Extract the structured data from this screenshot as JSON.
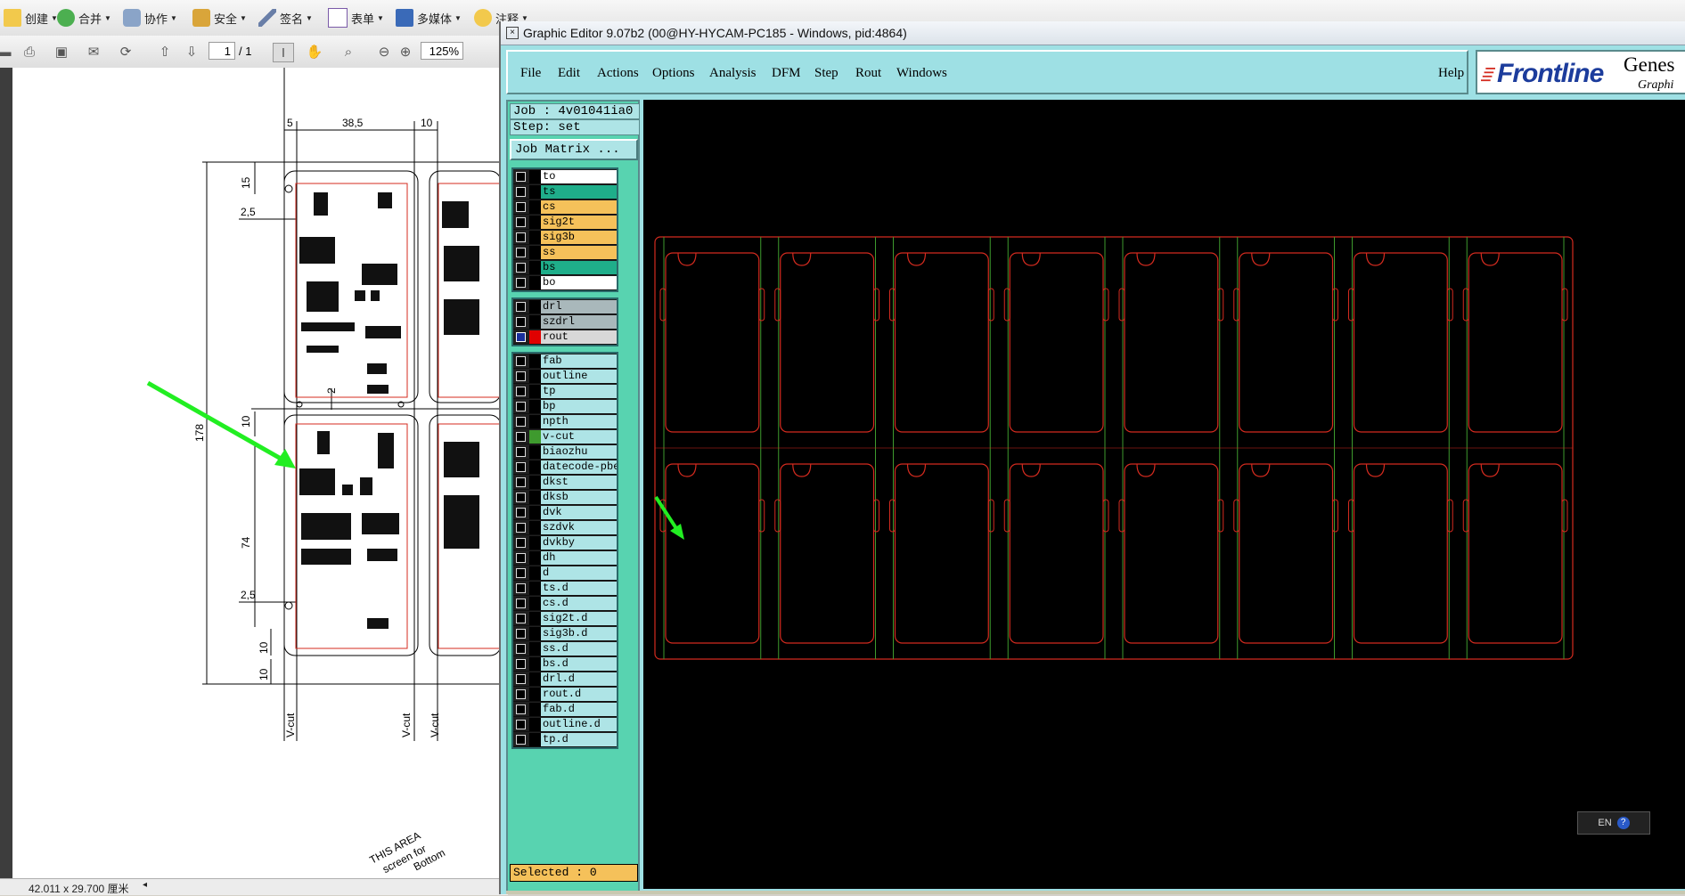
{
  "acrobat": {
    "toolbar1": [
      {
        "label": "创建",
        "icon": "create-icon"
      },
      {
        "label": "合并",
        "icon": "combine-icon"
      },
      {
        "label": "协作",
        "icon": "collaborate-icon"
      },
      {
        "label": "安全",
        "icon": "lock-icon"
      },
      {
        "label": "签名",
        "icon": "pen-icon"
      },
      {
        "label": "表单",
        "icon": "form-icon"
      },
      {
        "label": "多媒体",
        "icon": "multimedia-icon"
      },
      {
        "label": "注释",
        "icon": "comment-icon"
      }
    ],
    "page_current": "1",
    "page_total": "/ 1",
    "zoom": "125%",
    "status_size": "42.011 x 29.700 厘米",
    "drawing": {
      "dim_5": "5",
      "dim_38_5": "38,5",
      "dim_10_top": "10",
      "dim_15": "15",
      "dim_2_5_top": "2,5",
      "dim_178": "178",
      "dim_10_mid": "10",
      "dim_2": "2",
      "dim_74": "74",
      "dim_2_5_bot": "2,5",
      "dim_10_bot1": "10",
      "dim_10_bot2": "10",
      "vcut1": "V-cut",
      "vcut2": "V-cut",
      "vcut3": "V-cut",
      "note_line1": "THIS AREA",
      "note_line2": "screen for",
      "note_line3": "Bottom"
    }
  },
  "genesis": {
    "title": "Graphic Editor 9.07b2 (00@HY-HYCAM-PC185 - Windows, pid:4864)",
    "menu": [
      {
        "label": "File"
      },
      {
        "label": "Edit"
      },
      {
        "label": "Actions"
      },
      {
        "label": "Options"
      },
      {
        "label": "Analysis"
      },
      {
        "label": "DFM"
      },
      {
        "label": "Step"
      },
      {
        "label": "Rout"
      },
      {
        "label": "Windows"
      }
    ],
    "help": "Help",
    "logo_brand": "Frontline",
    "logo_product": "Genes",
    "logo_sub": "Graphi",
    "job": "Job : 4v01041ia0",
    "step": "Step: set",
    "job_matrix": "Job Matrix ...",
    "layer_groups": [
      {
        "layers": [
          {
            "name": "to",
            "color": "#ffffff",
            "swatch": "#000000"
          },
          {
            "name": "ts",
            "color": "#1fae8a",
            "swatch": "#000000"
          },
          {
            "name": "cs",
            "color": "#f5c15a",
            "swatch": "#000000"
          },
          {
            "name": "sig2t",
            "color": "#f5c15a",
            "swatch": "#000000"
          },
          {
            "name": "sig3b",
            "color": "#f5c15a",
            "swatch": "#000000"
          },
          {
            "name": "ss",
            "color": "#f5c15a",
            "swatch": "#000000"
          },
          {
            "name": "bs",
            "color": "#1fae8a",
            "swatch": "#000000"
          },
          {
            "name": "bo",
            "color": "#ffffff",
            "swatch": "#000000"
          }
        ]
      },
      {
        "layers": [
          {
            "name": "drl",
            "color": "#a9b8bb",
            "swatch": "#000000"
          },
          {
            "name": "szdrl",
            "color": "#a9b8bb",
            "swatch": "#000000"
          },
          {
            "name": "rout",
            "color": "#d8d8d8",
            "swatch": "#e00000",
            "checked": true
          }
        ]
      },
      {
        "layers": [
          {
            "name": "fab",
            "color": "#aee4e6",
            "swatch": "#000000"
          },
          {
            "name": "outline",
            "color": "#aee4e6",
            "swatch": "#000000"
          },
          {
            "name": "tp",
            "color": "#aee4e6",
            "swatch": "#000000"
          },
          {
            "name": "bp",
            "color": "#aee4e6",
            "swatch": "#000000"
          },
          {
            "name": "npth",
            "color": "#aee4e6",
            "swatch": "#000000"
          },
          {
            "name": "v-cut",
            "color": "#aee4e6",
            "swatch": "#3e9a2e"
          },
          {
            "name": "biaozhu",
            "color": "#aee4e6",
            "swatch": "#000000"
          },
          {
            "name": "datecode-pbe",
            "color": "#aee4e6",
            "swatch": "#000000"
          },
          {
            "name": "dkst",
            "color": "#aee4e6",
            "swatch": "#000000"
          },
          {
            "name": "dksb",
            "color": "#aee4e6",
            "swatch": "#000000"
          },
          {
            "name": "dvk",
            "color": "#aee4e6",
            "swatch": "#000000"
          },
          {
            "name": "szdvk",
            "color": "#aee4e6",
            "swatch": "#000000"
          },
          {
            "name": "dvkby",
            "color": "#aee4e6",
            "swatch": "#000000"
          },
          {
            "name": "dh",
            "color": "#aee4e6",
            "swatch": "#000000"
          },
          {
            "name": "d",
            "color": "#aee4e6",
            "swatch": "#000000"
          },
          {
            "name": "ts.d",
            "color": "#aee4e6",
            "swatch": "#000000"
          },
          {
            "name": "cs.d",
            "color": "#aee4e6",
            "swatch": "#000000"
          },
          {
            "name": "sig2t.d",
            "color": "#aee4e6",
            "swatch": "#000000"
          },
          {
            "name": "sig3b.d",
            "color": "#aee4e6",
            "swatch": "#000000"
          },
          {
            "name": "ss.d",
            "color": "#aee4e6",
            "swatch": "#000000"
          },
          {
            "name": "bs.d",
            "color": "#aee4e6",
            "swatch": "#000000"
          },
          {
            "name": "drl.d",
            "color": "#aee4e6",
            "swatch": "#000000"
          },
          {
            "name": "rout.d",
            "color": "#aee4e6",
            "swatch": "#000000"
          },
          {
            "name": "fab.d",
            "color": "#aee4e6",
            "swatch": "#000000"
          },
          {
            "name": "outline.d",
            "color": "#aee4e6",
            "swatch": "#000000"
          },
          {
            "name": "tp.d",
            "color": "#aee4e6",
            "swatch": "#000000"
          }
        ]
      }
    ],
    "selected": "Selected : 0",
    "ime": "EN"
  },
  "colors": {
    "rout": "#d42b1f",
    "vcut": "#3e9a2e",
    "arrow": "#22ee22",
    "panel": "#58d3b0",
    "menubar": "#9ee0e4"
  }
}
